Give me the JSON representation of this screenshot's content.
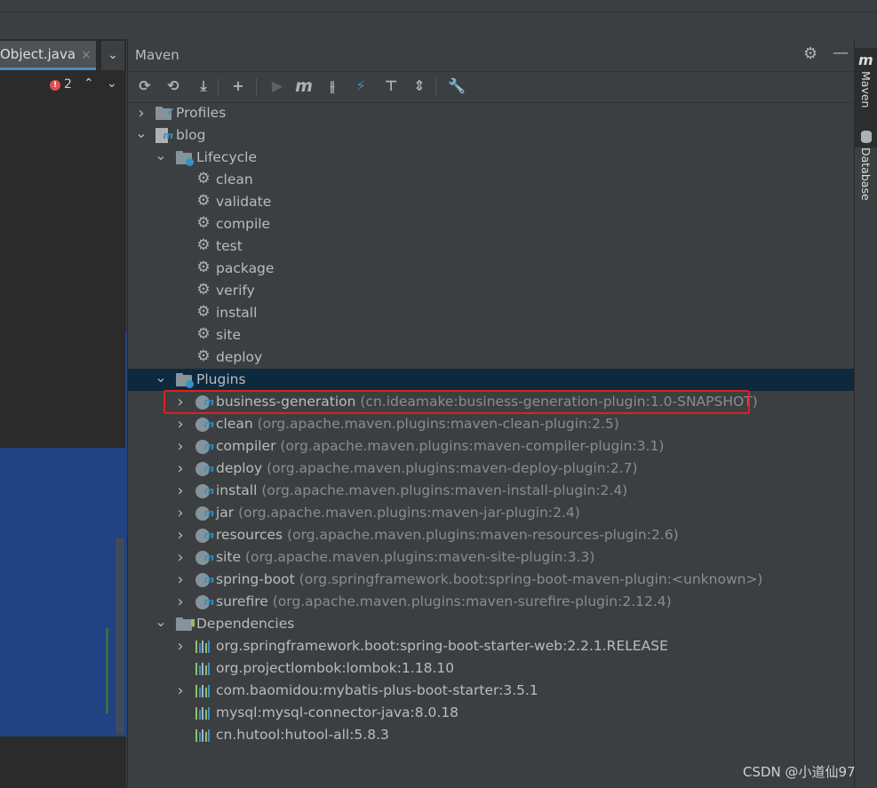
{
  "editor": {
    "tab_label": "Object.java",
    "tab_close": "×",
    "tab_more": "⌄",
    "error_count": "2"
  },
  "maven": {
    "title": "Maven",
    "toolbar": [
      {
        "name": "reload-icon",
        "glyph": "⟳"
      },
      {
        "name": "generate-sources-icon",
        "glyph": "⟲"
      },
      {
        "name": "download-icon",
        "glyph": "⤓"
      },
      {
        "name": "add-icon",
        "glyph": "+"
      },
      {
        "name": "run-icon",
        "glyph": "▶"
      },
      {
        "name": "execute-goal-icon",
        "glyph": "m"
      },
      {
        "name": "toggle-offline-icon",
        "glyph": "⫲"
      },
      {
        "name": "skip-tests-icon",
        "glyph": "⚡"
      },
      {
        "name": "show-dependencies-icon",
        "glyph": "⊤"
      },
      {
        "name": "collapse-all-icon",
        "glyph": "⇕"
      },
      {
        "name": "settings-wrench-icon",
        "glyph": "🔧"
      }
    ],
    "tree": [
      {
        "label": "Profiles",
        "sub": "",
        "icon": "profiles",
        "expanded": false,
        "depth": 0
      },
      {
        "label": "blog",
        "sub": "",
        "icon": "project",
        "expanded": true,
        "depth": 0
      },
      {
        "label": "Lifecycle",
        "sub": "",
        "icon": "folder",
        "expanded": true,
        "depth": 1
      },
      {
        "label": "clean",
        "sub": "",
        "icon": "gear",
        "depth": 2
      },
      {
        "label": "validate",
        "sub": "",
        "icon": "gear",
        "depth": 2
      },
      {
        "label": "compile",
        "sub": "",
        "icon": "gear",
        "depth": 2
      },
      {
        "label": "test",
        "sub": "",
        "icon": "gear",
        "depth": 2
      },
      {
        "label": "package",
        "sub": "",
        "icon": "gear",
        "depth": 2
      },
      {
        "label": "verify",
        "sub": "",
        "icon": "gear",
        "depth": 2
      },
      {
        "label": "install",
        "sub": "",
        "icon": "gear",
        "depth": 2
      },
      {
        "label": "site",
        "sub": "",
        "icon": "gear",
        "depth": 2
      },
      {
        "label": "deploy",
        "sub": "",
        "icon": "gear",
        "depth": 2
      },
      {
        "label": "Plugins",
        "sub": "",
        "icon": "folder",
        "expanded": true,
        "depth": 1,
        "selected": true
      },
      {
        "label": "business-generation",
        "sub": "(cn.ideamake:business-generation-plugin:1.0-SNAPSHOT)",
        "icon": "plugin",
        "expanded": false,
        "depth": 2
      },
      {
        "label": "clean",
        "sub": "(org.apache.maven.plugins:maven-clean-plugin:2.5)",
        "icon": "plugin",
        "expanded": false,
        "depth": 2
      },
      {
        "label": "compiler",
        "sub": "(org.apache.maven.plugins:maven-compiler-plugin:3.1)",
        "icon": "plugin",
        "expanded": false,
        "depth": 2
      },
      {
        "label": "deploy",
        "sub": "(org.apache.maven.plugins:maven-deploy-plugin:2.7)",
        "icon": "plugin",
        "expanded": false,
        "depth": 2
      },
      {
        "label": "install",
        "sub": "(org.apache.maven.plugins:maven-install-plugin:2.4)",
        "icon": "plugin",
        "expanded": false,
        "depth": 2
      },
      {
        "label": "jar",
        "sub": "(org.apache.maven.plugins:maven-jar-plugin:2.4)",
        "icon": "plugin",
        "expanded": false,
        "depth": 2
      },
      {
        "label": "resources",
        "sub": "(org.apache.maven.plugins:maven-resources-plugin:2.6)",
        "icon": "plugin",
        "expanded": false,
        "depth": 2
      },
      {
        "label": "site",
        "sub": "(org.apache.maven.plugins:maven-site-plugin:3.3)",
        "icon": "plugin",
        "expanded": false,
        "depth": 2
      },
      {
        "label": "spring-boot",
        "sub": "(org.springframework.boot:spring-boot-maven-plugin:<unknown>)",
        "icon": "plugin",
        "expanded": false,
        "depth": 2
      },
      {
        "label": "surefire",
        "sub": "(org.apache.maven.plugins:maven-surefire-plugin:2.12.4)",
        "icon": "plugin",
        "expanded": false,
        "depth": 2
      },
      {
        "label": "Dependencies",
        "sub": "",
        "icon": "deps-folder",
        "expanded": true,
        "depth": 1
      },
      {
        "label": "org.springframework.boot:spring-boot-starter-web:2.2.1.RELEASE",
        "sub": "",
        "icon": "library",
        "expanded": false,
        "depth": 2
      },
      {
        "label": "org.projectlombok:lombok:1.18.10",
        "sub": "",
        "icon": "library",
        "depth": 2
      },
      {
        "label": "com.baomidou:mybatis-plus-boot-starter:3.5.1",
        "sub": "",
        "icon": "library",
        "expanded": false,
        "depth": 2
      },
      {
        "label": "mysql:mysql-connector-java:8.0.18",
        "sub": "",
        "icon": "library",
        "depth": 2
      },
      {
        "label": "cn.hutool:hutool-all:5.8.3",
        "sub": "",
        "icon": "library",
        "depth": 2
      }
    ]
  },
  "right_strip": {
    "maven_tab": "Maven",
    "database_tab": "Database"
  },
  "watermark": "CSDN @小道仙97",
  "colors": {
    "accent": "#3592c4",
    "highlight_box": "#e02020",
    "selection": "#0d293e"
  }
}
